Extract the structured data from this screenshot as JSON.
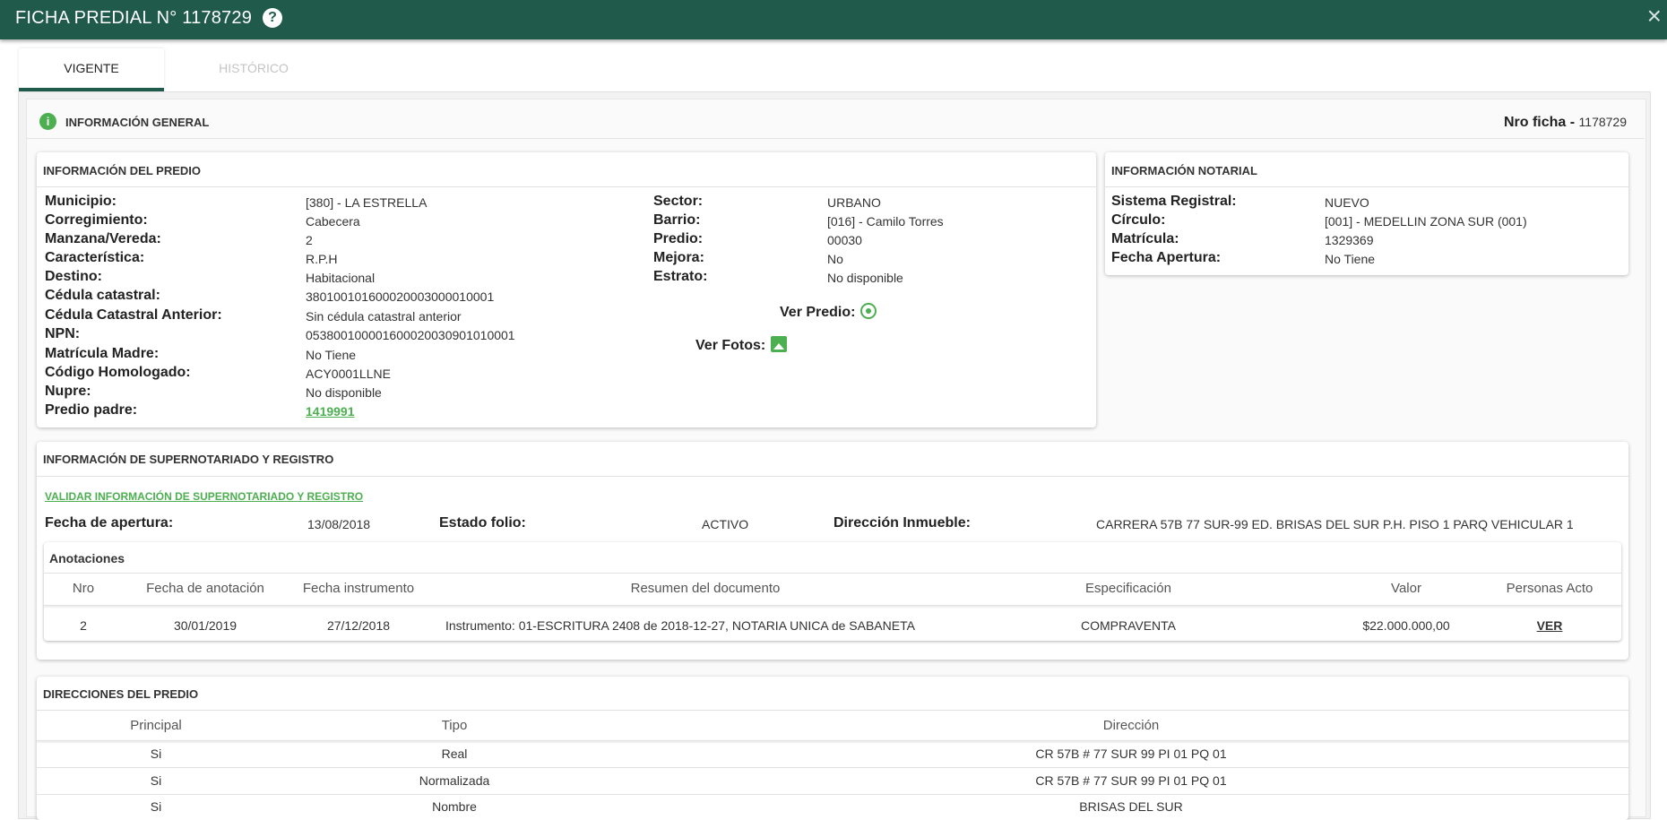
{
  "window": {
    "title": "FICHA PREDIAL N° 1178729",
    "help_icon": "help-icon",
    "close_icon": "×"
  },
  "tabs": [
    {
      "label": "VIGENTE",
      "active": true
    },
    {
      "label": "HISTÓRICO",
      "active": false
    }
  ],
  "general": {
    "title": "INFORMACIÓN GENERAL",
    "nro_ficha_label": "Nro ficha -",
    "nro_ficha_value": "1178729"
  },
  "predio": {
    "title": "INFORMACIÓN DEL PREDIO",
    "left": [
      {
        "label": "Municipio:",
        "value": "[380] - LA ESTRELLA"
      },
      {
        "label": "Corregimiento:",
        "value": "Cabecera"
      },
      {
        "label": "Manzana/Vereda:",
        "value": "2"
      },
      {
        "label": "Característica:",
        "value": "R.P.H"
      },
      {
        "label": "Destino:",
        "value": "Habitacional"
      },
      {
        "label": "Cédula catastral:",
        "value": "380100101600020003000010001"
      },
      {
        "label": "Cédula Catastral Anterior:",
        "value": "Sin cédula catastral anterior"
      },
      {
        "label": "NPN:",
        "value": "053800100001600020030901010001"
      },
      {
        "label": "Matrícula Madre:",
        "value": "No Tiene"
      },
      {
        "label": "Código Homologado:",
        "value": "ACY0001LLNE"
      },
      {
        "label": "Nupre:",
        "value": "No disponible"
      },
      {
        "label": "Predio padre:",
        "value": "1419991"
      }
    ],
    "right": [
      {
        "label": "Sector:",
        "value": "URBANO"
      },
      {
        "label": "Barrio:",
        "value": "[016] - Camilo Torres"
      },
      {
        "label": "Predio:",
        "value": "00030"
      },
      {
        "label": "Mejora:",
        "value": "No"
      },
      {
        "label": "Estrato:",
        "value": "No disponible"
      }
    ],
    "ver_predio": "Ver Predio:",
    "ver_fotos": "Ver Fotos:"
  },
  "notarial": {
    "title": "INFORMACIÓN NOTARIAL",
    "rows": [
      {
        "label": "Sistema Registral:",
        "value": "NUEVO"
      },
      {
        "label": "Círculo:",
        "value": "[001] - MEDELLIN ZONA SUR (001)"
      },
      {
        "label": "Matrícula:",
        "value": "1329369"
      },
      {
        "label": "Fecha Apertura:",
        "value": "No Tiene"
      }
    ]
  },
  "supernotariado": {
    "title": "INFORMACIÓN DE SUPERNOTARIADO Y REGISTRO",
    "validate_link": "VALIDAR INFORMACIÓN DE SUPERNOTARIADO Y REGISTRO",
    "fecha_apertura_label": "Fecha de apertura:",
    "fecha_apertura_value": "13/08/2018",
    "estado_folio_label": "Estado folio:",
    "estado_folio_value": "ACTIVO",
    "direccion_label": "Dirección Inmueble:",
    "direccion_value": "CARRERA 57B 77 SUR-99 ED. BRISAS DEL SUR P.H. PISO 1 PARQ VEHICULAR 1",
    "anotaciones": {
      "title": "Anotaciones",
      "columns": [
        "Nro",
        "Fecha de anotación",
        "Fecha instrumento",
        "Resumen del documento",
        "Especificación",
        "Valor",
        "Personas Acto"
      ],
      "rows": [
        [
          "2",
          "30/01/2019",
          "27/12/2018",
          "Instrumento: 01-ESCRITURA 2408 de 2018-12-27, NOTARIA UNICA de SABANETA",
          "COMPRAVENTA",
          "$22.000.000,00",
          "VER"
        ]
      ]
    }
  },
  "direcciones": {
    "title": "DIRECCIONES DEL PREDIO",
    "columns": [
      "Principal",
      "Tipo",
      "Dirección"
    ],
    "rows": [
      [
        "Si",
        "Real",
        "CR 57B # 77 SUR 99 PI 01 PQ 01"
      ],
      [
        "Si",
        "Normalizada",
        "CR 57B # 77 SUR 99 PI 01 PQ 01"
      ],
      [
        "Si",
        "Nombre",
        "BRISAS DEL SUR"
      ]
    ]
  }
}
